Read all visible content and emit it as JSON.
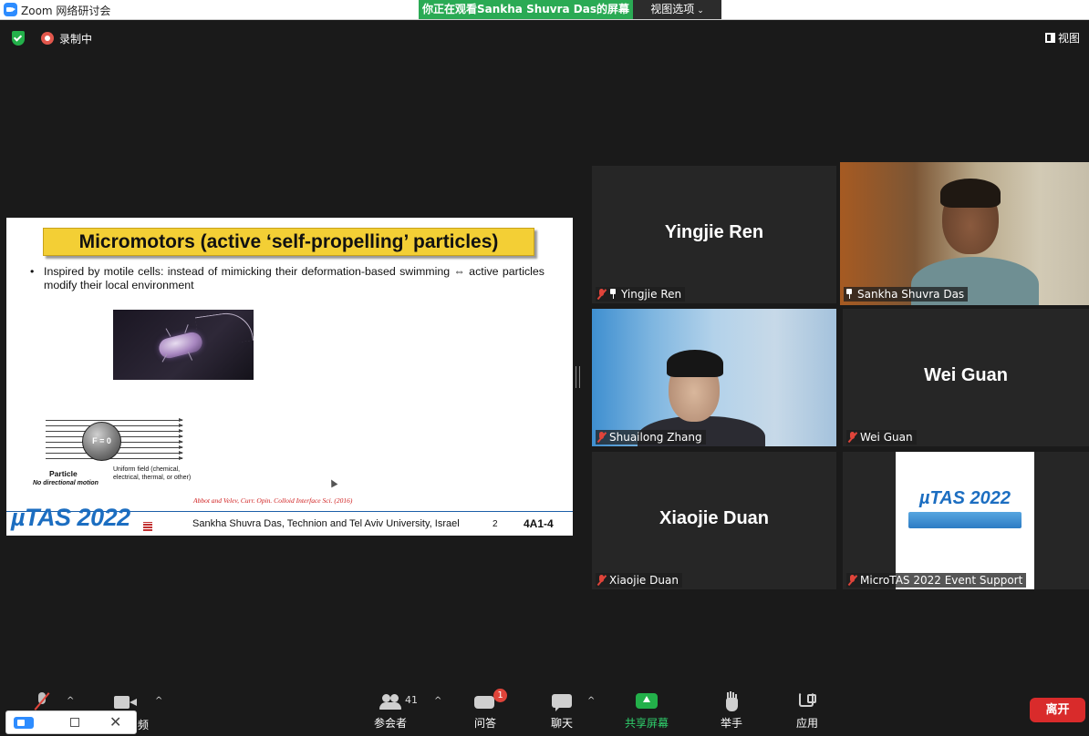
{
  "window": {
    "title": "Zoom 网络研讨会",
    "share_banner": "你正在观看Sankha Shuvra Das的屏幕",
    "view_options": "视图选项",
    "view_options_caret": "⌄"
  },
  "top_bar": {
    "recording_label": "录制中",
    "view_label": "视图"
  },
  "slide": {
    "title": "Micromotors (active ‘self-propelling’ particles)",
    "bullet_marker": "•",
    "bullet": "Inspired by motile cells: instead of mimicking their deformation-based swimming ⇔ active particles modify their local environment",
    "sphere_label": "F = 0",
    "particle_label": "Particle",
    "particle_sub": "No directional motion",
    "field_label": "Uniform field (chemical, electrical, thermal, or other)",
    "citation": "Abbot and Velev, Curr. Opin. Colloid Interface Sci. (2016)",
    "logo": "µTAS 2022",
    "footer_author": "Sankha Shuvra Das, Technion and Tel Aviv University, Israel",
    "footer_page": "2",
    "footer_code": "4A1-4"
  },
  "tiles": {
    "yingjie": {
      "center_name": "Yingjie Ren",
      "label": "Yingjie Ren"
    },
    "sankha": {
      "label": "Sankha Shuvra Das"
    },
    "shuailong": {
      "label": "Shuailong Zhang"
    },
    "wei": {
      "center_name": "Wei Guan",
      "label": "Wei Guan"
    },
    "xiaojie": {
      "center_name": "Xiaojie Duan",
      "label": "Xiaojie Duan"
    },
    "microtas": {
      "label": "MicroTAS 2022 Event Support",
      "poster_logo": "µTAS 2022"
    }
  },
  "toolbar": {
    "video_label": "频",
    "participants_label": "参会者",
    "participants_count": "41",
    "qa_label": "问答",
    "qa_badge": "1",
    "chat_label": "聊天",
    "share_label": "共享屏幕",
    "raise_hand_label": "举手",
    "apps_label": "应用",
    "leave_label": "离开",
    "caret": "^",
    "close_glyph": "✕"
  },
  "colors": {
    "accent_green": "#23b04a",
    "active_speaker_border": "#c8e86a",
    "leave_red": "#d92b2b",
    "slide_title_bg": "#f3cf35"
  }
}
